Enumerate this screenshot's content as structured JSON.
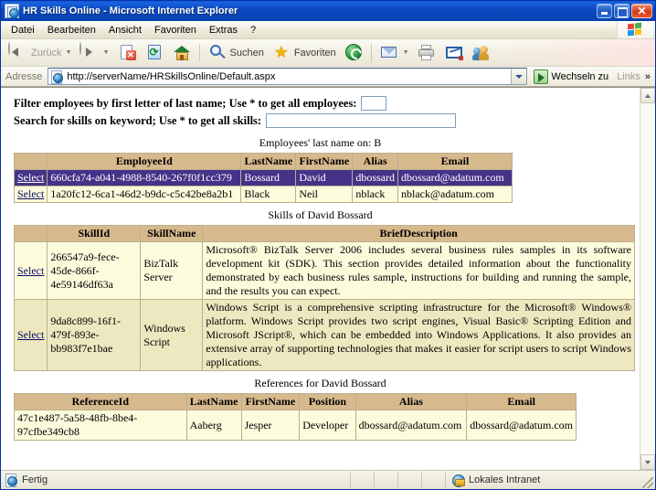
{
  "window": {
    "title": "HR Skills Online - Microsoft Internet Explorer",
    "minimize_label": "",
    "maximize_label": "",
    "close_label": "✕"
  },
  "menu": {
    "items": [
      {
        "label": "Datei"
      },
      {
        "label": "Bearbeiten"
      },
      {
        "label": "Ansicht"
      },
      {
        "label": "Favoriten"
      },
      {
        "label": "Extras"
      },
      {
        "label": "?"
      }
    ]
  },
  "toolbar": {
    "back_label": "Zurück",
    "search_label": "Suchen",
    "favorites_label": "Favoriten"
  },
  "address": {
    "label": "Adresse",
    "url": "http://serverName/HRSkillsOnline/Default.aspx",
    "go_label": "Wechseln zu",
    "links_label": "Links",
    "links_chevron": "»"
  },
  "page": {
    "filter_label": "Filter employees by first letter of last name; Use * to get all employees:",
    "filter_value": "",
    "search_label": "Search for skills on keyword; Use * to get all skills:",
    "search_value": "",
    "employees_caption": "Employees' last name on: B",
    "skills_caption": "Skills of David Bossard",
    "references_caption": "References for David Bossard",
    "select_label": "Select",
    "employees_table": {
      "headers": [
        "",
        "EmployeeId",
        "LastName",
        "FirstName",
        "Alias",
        "Email"
      ],
      "rows": [
        {
          "selected": true,
          "select": "Select",
          "employee_id": "660cfa74-a041-4988-8540-267f0f1cc379",
          "last_name": "Bossard",
          "first_name": "David",
          "alias": "dbossard",
          "email": "dbossard@adatum.com"
        },
        {
          "selected": false,
          "select": "Select",
          "employee_id": "1a20fc12-6ca1-46d2-b9dc-c5c42be8a2b1",
          "last_name": "Black",
          "first_name": "Neil",
          "alias": "nblack",
          "email": "nblack@adatum.com"
        }
      ]
    },
    "skills_table": {
      "headers": [
        "",
        "SkillId",
        "SkillName",
        "BriefDescription"
      ],
      "rows": [
        {
          "select": "Select",
          "skill_id": "266547a9-fece-45de-866f-4e59146df63a",
          "skill_name": "BizTalk Server",
          "brief_description": "Microsoft® BizTalk Server 2006 includes several business rules samples in its software development kit (SDK). This section provides detailed information about the functionality demonstrated by each business rules sample, instructions for building and running the sample, and the results you can expect."
        },
        {
          "select": "Select",
          "skill_id": "9da8c899-16f1-479f-893e-bb983f7e1bae",
          "skill_name": "Windows Script",
          "brief_description": "Windows Script is a comprehensive scripting infrastructure for the Microsoft® Windows® platform. Windows Script provides two script engines, Visual Basic® Scripting Edition and Microsoft JScript®, which can be embedded into Windows Applications. It also provides an extensive array of supporting technologies that makes it easier for script users to script Windows applications."
        }
      ]
    },
    "references_table": {
      "headers": [
        "ReferenceId",
        "LastName",
        "FirstName",
        "Position",
        "Alias",
        "Email"
      ],
      "rows": [
        {
          "reference_id": "47c1e487-5a58-48fb-8be4-97cfbe349cb8",
          "last_name": "Aaberg",
          "first_name": "Jesper",
          "position": "Developer",
          "alias": "dbossard@adatum.com",
          "email": "dbossard@adatum.com"
        }
      ]
    }
  },
  "status": {
    "text": "Fertig",
    "zone": "Lokales Intranet"
  },
  "colors": {
    "titlebar_blue": "#0A4AC0",
    "table_header_tan": "#D7B98E",
    "row_yellow": "#FCFBDC",
    "row_alt": "#EEE8C0",
    "selected_purple": "#443388"
  }
}
